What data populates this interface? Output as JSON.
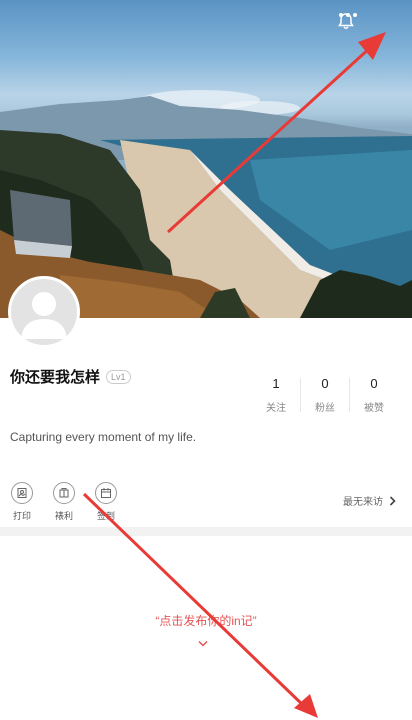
{
  "profile": {
    "username": "你还要我怎样",
    "level": "Lv1",
    "bio": "Capturing every moment of my life."
  },
  "stats": [
    {
      "value": "1",
      "label": "关注"
    },
    {
      "value": "0",
      "label": "粉丝"
    },
    {
      "value": "0",
      "label": "被赞"
    }
  ],
  "actions": [
    {
      "label": "打印",
      "icon": "print-icon"
    },
    {
      "label": "裱利",
      "icon": "frame-icon"
    },
    {
      "label": "签到",
      "icon": "checkin-icon"
    }
  ],
  "visitors": {
    "label": "最无来访"
  },
  "empty_state": {
    "prompt": "“点击发布你的in记”"
  },
  "colors": {
    "accent": "#e45454",
    "annotation_arrow": "#e83a36"
  }
}
